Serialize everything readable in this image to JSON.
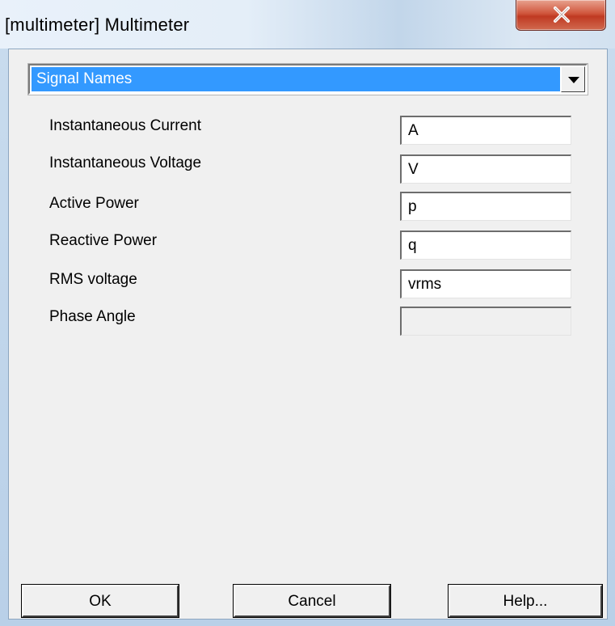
{
  "window": {
    "title": "[multimeter] Multimeter",
    "close_icon": "close-icon"
  },
  "dropdown": {
    "selected": "Signal Names",
    "arrow_icon": "chevron-down-icon"
  },
  "signals": [
    {
      "label": "Instantaneous Current",
      "value": "A",
      "enabled": true
    },
    {
      "label": "Instantaneous Voltage",
      "value": "V",
      "enabled": true
    },
    {
      "label": "Active Power",
      "value": "p",
      "enabled": true
    },
    {
      "label": "Reactive Power",
      "value": "q",
      "enabled": true
    },
    {
      "label": "RMS voltage",
      "value": "vrms",
      "enabled": true
    },
    {
      "label": "Phase Angle",
      "value": "",
      "enabled": false
    }
  ],
  "buttons": {
    "ok": "OK",
    "cancel": "Cancel",
    "help": "Help..."
  },
  "colors": {
    "selection": "#3399ff",
    "dialog_bg": "#f0f0f0",
    "close_button": "#c8452c"
  }
}
